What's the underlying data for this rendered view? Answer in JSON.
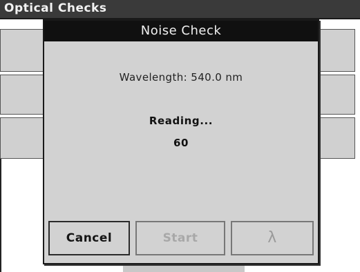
{
  "background_window": {
    "title": "Optical Checks"
  },
  "dialog": {
    "title": "Noise Check",
    "wavelength_label": "Wavelength: 540.0 nm",
    "status": "Reading...",
    "count": "60"
  },
  "buttons": {
    "cancel": "Cancel",
    "start": "Start",
    "lambda": "λ"
  },
  "colors": {
    "titlebar": "#101010",
    "dialog_background": "#d2d2d2",
    "disabled_text": "#a8a8a8"
  }
}
